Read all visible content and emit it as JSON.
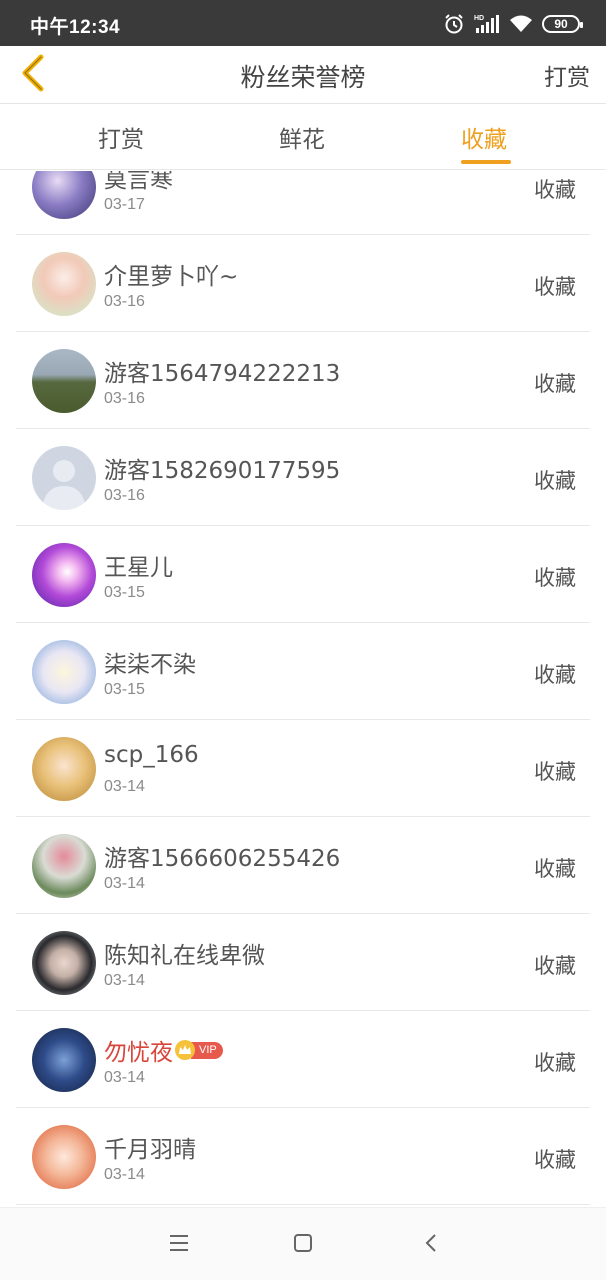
{
  "status_bar": {
    "time": "中午12:34",
    "battery": "90",
    "icons": [
      "alarm-icon",
      "hd-signal-icon",
      "wifi-icon",
      "battery-icon"
    ]
  },
  "header": {
    "back_icon": "chevron-left-icon",
    "title": "粉丝荣誉榜",
    "action_label": "打赏"
  },
  "tabs": [
    {
      "label": "打赏",
      "active": false
    },
    {
      "label": "鲜花",
      "active": false
    },
    {
      "label": "收藏",
      "active": true
    }
  ],
  "accent_color": "#f0a020",
  "vip_name_color": "#d8453a",
  "rows": [
    {
      "name": "莫言寒",
      "date": "03-17",
      "action": "收藏"
    },
    {
      "name": "介里萝卜吖~",
      "date": "03-16",
      "action": "收藏"
    },
    {
      "name": "游客1564794222213",
      "date": "03-16",
      "action": "收藏"
    },
    {
      "name": "游客1582690177595",
      "date": "03-16",
      "action": "收藏"
    },
    {
      "name": "王星儿",
      "date": "03-15",
      "action": "收藏"
    },
    {
      "name": "柒柒不染",
      "date": "03-15",
      "action": "收藏"
    },
    {
      "name": "scp_166",
      "date": "03-14",
      "action": "收藏"
    },
    {
      "name": "游客1566606255426",
      "date": "03-14",
      "action": "收藏"
    },
    {
      "name": "陈知礼在线卑微",
      "date": "03-14",
      "action": "收藏"
    },
    {
      "name": "勿忧夜",
      "date": "03-14",
      "action": "收藏",
      "vip": "VIP"
    },
    {
      "name": "千月羽晴",
      "date": "03-14",
      "action": "收藏"
    }
  ],
  "nav_bar": {
    "icons": [
      "menu-icon",
      "home-square-icon",
      "back-triangle-icon"
    ]
  }
}
